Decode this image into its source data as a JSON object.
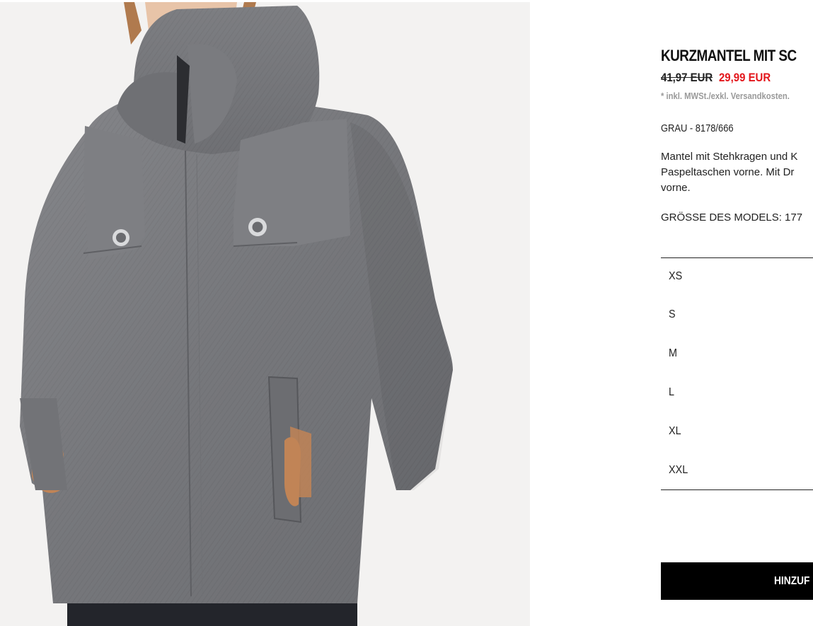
{
  "product": {
    "title": "KURZMANTEL MIT SC",
    "old_price": "41,97 EUR",
    "sale_price": "29,99 EUR",
    "tax_note": "* inkl. MWSt./exkl. Versandkosten.",
    "color_ref": "GRAU - 8178/666",
    "description_lines": [
      "Mantel mit Stehkragen und K",
      "Paspeltaschen vorne. Mit Dr",
      "vorne."
    ],
    "model_size": "GRÖSSE DES MODELS: 177",
    "image_icon": "product-photo-grey-short-coat"
  },
  "sizes": [
    {
      "label": "XS"
    },
    {
      "label": "S"
    },
    {
      "label": "M"
    },
    {
      "label": "L"
    },
    {
      "label": "XL"
    },
    {
      "label": "XXL"
    }
  ],
  "actions": {
    "add_label": "HINZUF"
  },
  "colors": {
    "sale_red": "#e3161b",
    "button_black": "#000000",
    "coat_grey": "#7b7c7f"
  }
}
